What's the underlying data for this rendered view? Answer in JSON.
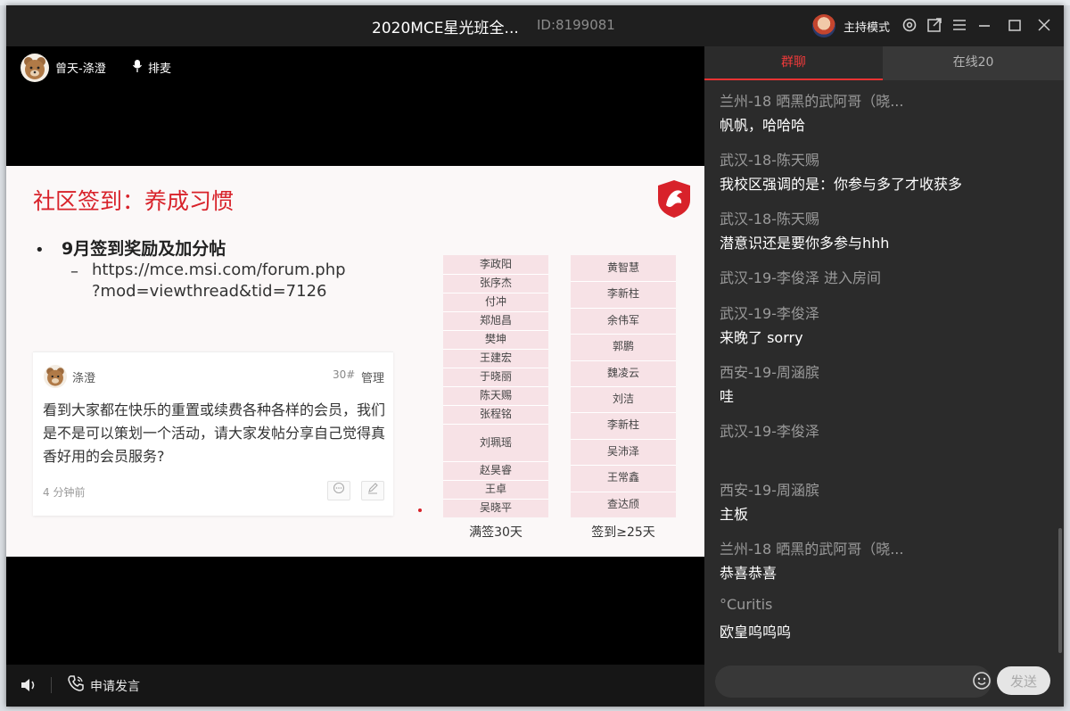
{
  "window": {
    "title": "2020MCE星光班全...",
    "room_id": "ID:8199081",
    "host_mode_label": "主持模式"
  },
  "presenter": {
    "name": "曾天-涤澄",
    "mic_label": "排麦"
  },
  "slide": {
    "title": "社区签到：养成习惯",
    "bullet_title": "9月签到奖励及加分帖",
    "link_line1": "https://mce.msi.com/forum.php",
    "link_line2": "?mod=viewthread&tid=7126",
    "post": {
      "author": "涤澄",
      "floor": "30#",
      "manage_label": "管理",
      "body": "看到大家都在快乐的重置或续费各种各样的会员，我们是不是可以策划一个活动，请大家发帖分享自己觉得真香好用的会员服务?",
      "time": "4 分钟前"
    },
    "full_checkin": {
      "caption": "满签30天",
      "names": [
        "李政阳",
        "张序杰",
        "付冲",
        "郑旭昌",
        "樊坤",
        "王建宏",
        "于晓丽",
        "陈天赐",
        "张程铭",
        "刘珮瑶",
        "赵昊睿",
        "王卓",
        "吴晓平"
      ]
    },
    "checkin_25": {
      "caption": "签到≥25天",
      "names": [
        "黄智慧",
        "李新柱",
        "余伟军",
        "郭鹏",
        "魏凌云",
        "刘洁",
        "李新柱",
        "吴沛泽",
        "王常鑫",
        "查达颀"
      ]
    }
  },
  "bottom_bar": {
    "apply_label": "申请发言"
  },
  "chat": {
    "tab_group": "群聊",
    "tab_online": "在线20",
    "messages": [
      {
        "sender": "兰州-18 晒黑的武阿哥（晓...",
        "text": "帆帆，哈哈哈"
      },
      {
        "sender": "武汉-18-陈天赐",
        "text": "我校区强调的是：你参与多了才收获多"
      },
      {
        "sender": "武汉-18-陈天赐",
        "text": "潜意识还是要你多参与hhh"
      },
      {
        "sender": "武汉-19-李俊泽 进入房间",
        "text": ""
      },
      {
        "sender": "武汉-19-李俊泽",
        "text": "来晚了 sorry"
      },
      {
        "sender": "西安-19-周涵膑",
        "text": "哇"
      },
      {
        "sender": "武汉-19-李俊泽",
        "text": ""
      },
      {
        "sender": "西安-19-周涵膑",
        "text": "主板"
      },
      {
        "sender": "兰州-18 晒黑的武阿哥（晓...",
        "text": "恭喜恭喜"
      },
      {
        "sender": "°Curitis",
        "text": "欧皇呜呜呜"
      }
    ],
    "input_placeholder": "",
    "send_label": "发送"
  },
  "icons": [
    "settings-icon",
    "popout-icon",
    "menu-icon",
    "minimize-icon",
    "maximize-icon",
    "close-icon",
    "microphone-icon",
    "volume-icon",
    "phone-icon",
    "emoji-icon"
  ],
  "colors": {
    "accent_red": "#e33a3a",
    "slide_title_red": "#d8222a",
    "chat_bg": "#2b2b2b",
    "titlebar_bg": "#1f1f1f"
  }
}
